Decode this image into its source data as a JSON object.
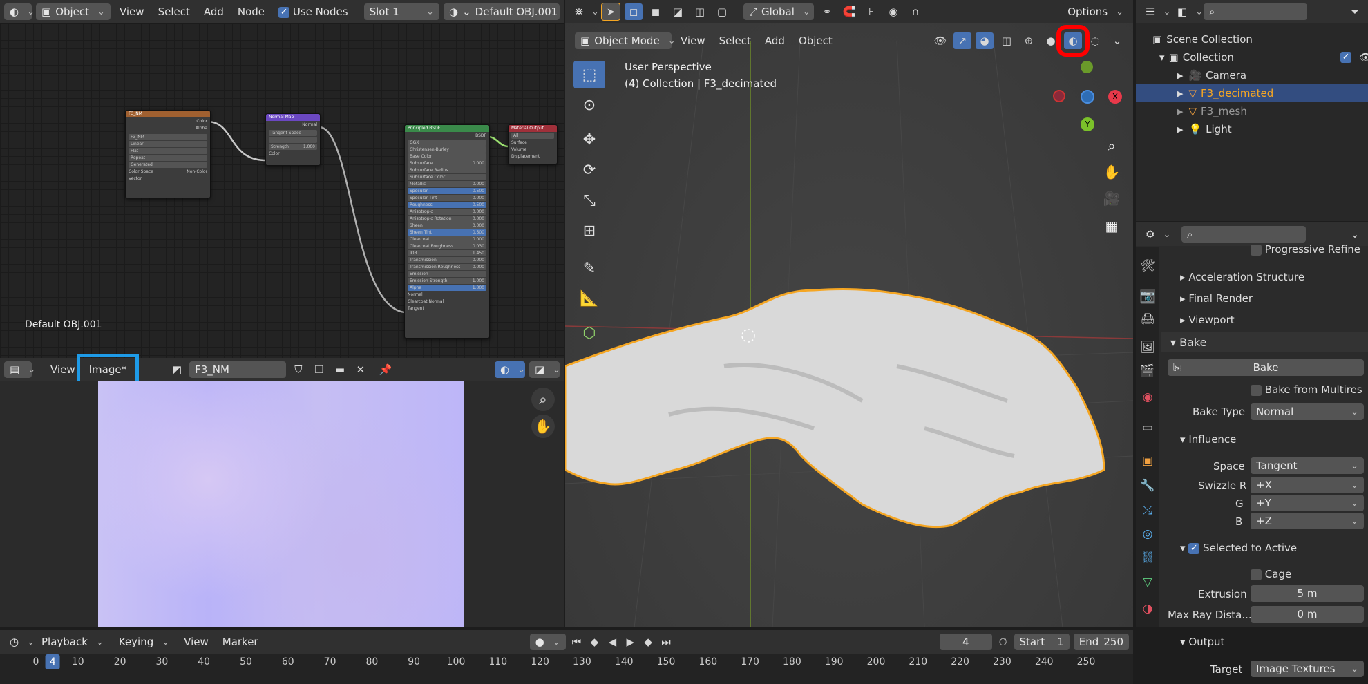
{
  "node_editor": {
    "header": {
      "object_mode": "Object",
      "menu_view": "View",
      "menu_select": "Select",
      "menu_add": "Add",
      "menu_node": "Node",
      "use_nodes": "Use Nodes",
      "slot": "Slot 1",
      "material": "Default OBJ.001"
    },
    "material_label": "Default OBJ.001",
    "nodes": {
      "image_texture": {
        "title": "F3_NM",
        "out_color": "Color",
        "out_alpha": "Alpha",
        "image": "F3_NM",
        "rows": [
          "Linear",
          "Flat",
          "Repeat",
          "Generated"
        ],
        "color_space": "Color Space",
        "non_color": "Non-Color",
        "vector": "Vector"
      },
      "normal_map": {
        "title": "Normal Map",
        "out_normal": "Normal",
        "space": "Tangent Space",
        "strength": "Strength",
        "strength_value": "1.000",
        "in_color": "Color"
      },
      "principled": {
        "title": "Principled BSDF",
        "out_bsdf": "BSDF",
        "distribution": "GGX",
        "subsurface_method": "Christensen-Burley",
        "inputs": [
          {
            "label": "Base Color",
            "value": ""
          },
          {
            "label": "Subsurface",
            "value": "0.000"
          },
          {
            "label": "Subsurface Radius",
            "value": ""
          },
          {
            "label": "Subsurface Color",
            "value": ""
          },
          {
            "label": "Metallic",
            "value": "0.000"
          },
          {
            "label": "Specular",
            "value": "0.500"
          },
          {
            "label": "Specular Tint",
            "value": "0.000"
          },
          {
            "label": "Roughness",
            "value": "0.500"
          },
          {
            "label": "Anisotropic",
            "value": "0.000"
          },
          {
            "label": "Anisotropic Rotation",
            "value": "0.000"
          },
          {
            "label": "Sheen",
            "value": "0.000"
          },
          {
            "label": "Sheen Tint",
            "value": "0.500"
          },
          {
            "label": "Clearcoat",
            "value": "0.000"
          },
          {
            "label": "Clearcoat Roughness",
            "value": "0.030"
          },
          {
            "label": "IOR",
            "value": "1.450"
          },
          {
            "label": "Transmission",
            "value": "0.000"
          },
          {
            "label": "Transmission Roughness",
            "value": "0.000"
          },
          {
            "label": "Emission",
            "value": ""
          },
          {
            "label": "Emission Strength",
            "value": "1.000"
          },
          {
            "label": "Alpha",
            "value": "1.000"
          }
        ],
        "normal": "Normal",
        "clearcoat_normal": "Clearcoat Normal",
        "tangent": "Tangent"
      },
      "material_output": {
        "title": "Material Output",
        "target": "All",
        "surface": "Surface",
        "volume": "Volume",
        "displacement": "Displacement"
      }
    }
  },
  "image_editor": {
    "menu_view": "View",
    "menu_image": "Image*",
    "image_name": "F3_NM"
  },
  "viewport": {
    "header": {
      "transform": "Global",
      "options": "Options",
      "mode": "Object Mode",
      "menu_view": "View",
      "menu_select": "Select",
      "menu_add": "Add",
      "menu_object": "Object"
    },
    "overlay_title": "User Perspective",
    "overlay_subtitle": "(4) Collection | F3_decimated",
    "gizmo": {
      "x": "X",
      "y": "Y"
    }
  },
  "outliner": {
    "root": "Scene Collection",
    "collection": "Collection",
    "items": [
      {
        "name": "Camera",
        "selected": false
      },
      {
        "name": "F3_decimated",
        "selected": true
      },
      {
        "name": "F3_mesh",
        "selected": false
      },
      {
        "name": "Light",
        "selected": false
      }
    ]
  },
  "properties": {
    "progressive_refine": "Progressive Refine",
    "acceleration": "Acceleration Structure",
    "final_render": "Final Render",
    "viewport": "Viewport",
    "bake_panel": "Bake",
    "bake_button": "Bake",
    "bake_from_multires": "Bake from Multires",
    "bake_type_label": "Bake Type",
    "bake_type_value": "Normal",
    "influence": "Influence",
    "space_label": "Space",
    "space_value": "Tangent",
    "swizzle_r_label": "Swizzle R",
    "swizzle_r": "+X",
    "g_label": "G",
    "swizzle_g": "+Y",
    "b_label": "B",
    "swizzle_b": "+Z",
    "selected_to_active": "Selected to Active",
    "cage": "Cage",
    "extrusion_label": "Extrusion",
    "extrusion_value": "5 m",
    "max_ray_label": "Max Ray Dista...",
    "max_ray_value": "0 m",
    "output": "Output",
    "target_label": "Target",
    "target_value": "Image Textures"
  },
  "timeline": {
    "playback": "Playback",
    "keying": "Keying",
    "menu_view": "View",
    "menu_marker": "Marker",
    "current_frame": "4",
    "start_label": "Start",
    "start_value": "1",
    "end_label": "End",
    "end_value": "250",
    "ticks": [
      "0",
      "4",
      "10",
      "20",
      "30",
      "40",
      "50",
      "60",
      "70",
      "80",
      "90",
      "100",
      "110",
      "120",
      "130",
      "140",
      "150",
      "160",
      "170",
      "180",
      "190",
      "200",
      "210",
      "220",
      "230",
      "240",
      "250"
    ]
  },
  "colors": {
    "accent": "#4772b3",
    "selection_orange": "#f5a623",
    "highlight_red": "#ff0000",
    "highlight_blue": "#1e9be8"
  }
}
